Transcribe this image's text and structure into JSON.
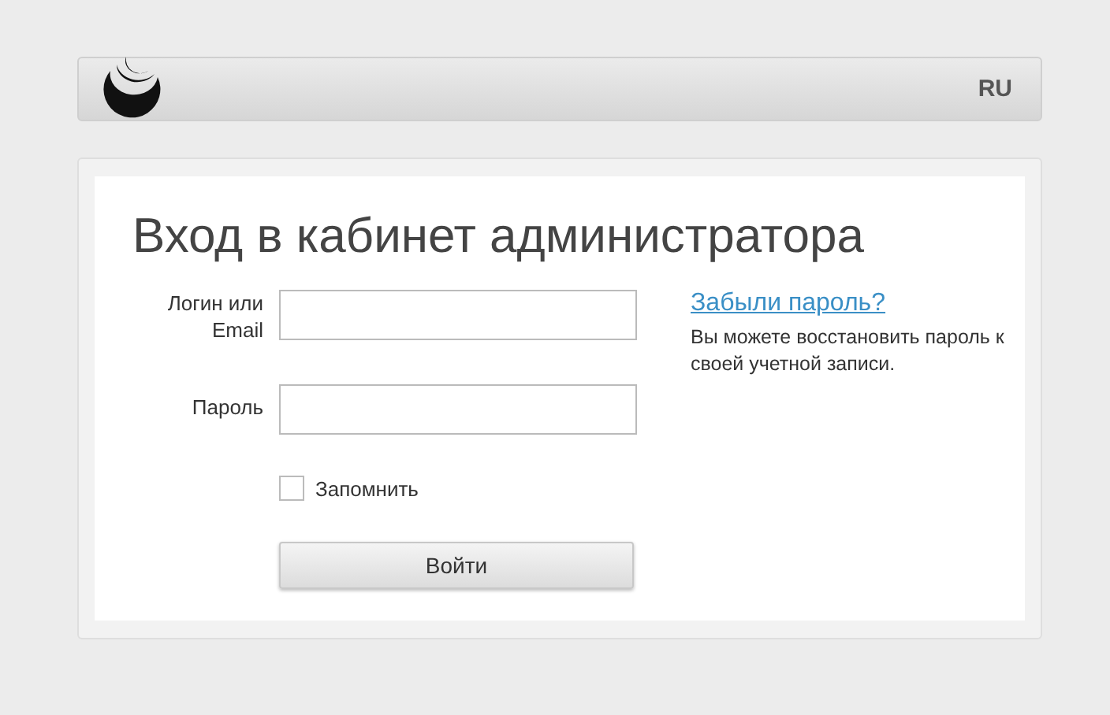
{
  "header": {
    "language": "RU"
  },
  "title": "Вход в кабинет администратора",
  "fields": [
    {
      "label": "Логин или Email"
    },
    {
      "label": "Пароль"
    }
  ],
  "remember": {
    "label": "Запомнить",
    "checked": false
  },
  "submit": "Войти",
  "forgot": {
    "link": "Забыли пароль?",
    "text": "Вы можете восстановить пароль к своей учетной записи."
  }
}
